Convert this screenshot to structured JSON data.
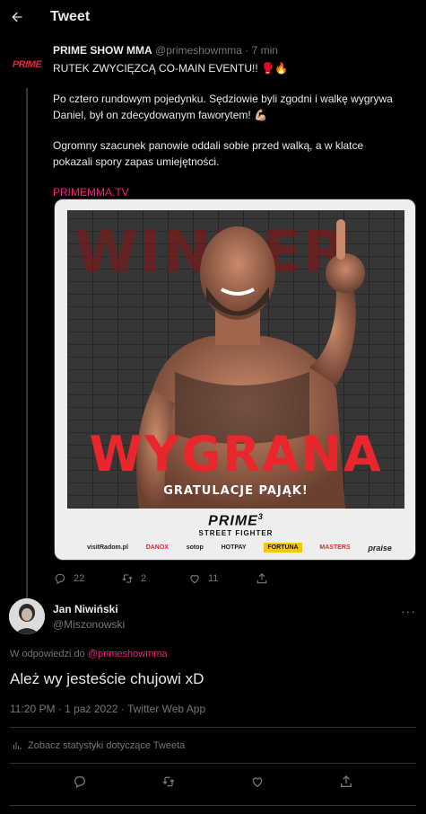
{
  "header": {
    "title": "Tweet"
  },
  "parent_tweet": {
    "avatar_text": "PRIME",
    "author": "PRIME SHOW MMA",
    "handle": "@primeshowmma",
    "separator": "·",
    "time": "7 min",
    "line1": "RUTEK ZWYCIĘZCĄ CO-MAIN EVENTU!! 🥊🔥",
    "para2": "Po cztero rundowym pojedynku. Sędziowie byli zgodni i walkę wygrywa Daniel, był on zdecydowanym faworytem! 💪🏼",
    "para3": "Ogromny szacunek panowie oddali sobie przed walką, a w klatce pokazali spory zapas umiejętności.",
    "link": "PRIMEMMA.TV",
    "media": {
      "bg_word": "WINNER",
      "headline": "WYGRANA",
      "subline": "GRATULACJE PAJĄK!",
      "brand_main": "PRIME",
      "brand_sup": "3",
      "brand_sub": "STREET FIGHTER",
      "sponsors": [
        "visitRadom.pl",
        "DANOX",
        "sotop",
        "HOTPAY",
        "FORTUNA",
        "MASTERS",
        "praise"
      ]
    },
    "stats": {
      "replies": "22",
      "retweets": "2",
      "likes": "11"
    }
  },
  "reply_tweet": {
    "author": "Jan Niwiński",
    "handle": "@Miszonowski",
    "more": "···",
    "reply_prefix": "W odpowiedzi do",
    "reply_to": "@primeshowmma",
    "text": "Ależ wy jesteście chujowi xD",
    "timestamp": "11:20 PM · 1 paź 2022 · Twitter Web App",
    "stats_link": "Zobacz statystyki dotyczące Tweeta"
  },
  "colors": {
    "accent_pink": "#f91880",
    "muted": "#71767b",
    "background": "#000000",
    "prime_red": "#e0243c"
  }
}
